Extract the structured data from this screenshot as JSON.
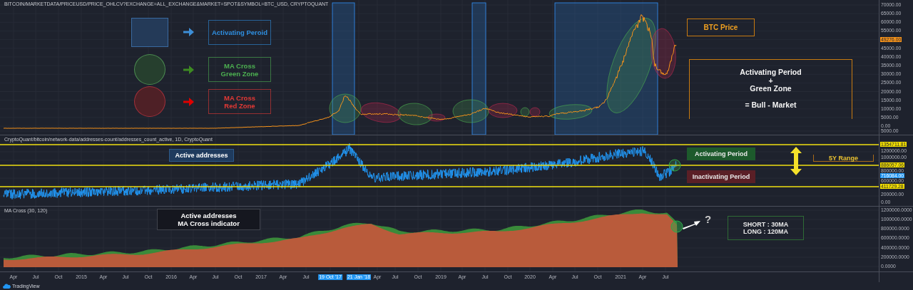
{
  "price_panel": {
    "source": "BITCOIN/MARKETDATA/PRICEUSD/PRICE_OHLCV?EXCHANGE=ALL_EXCHANGE&MARKET=SPOT&SYMBOL=BTC_USD, CRYPTOQUANT",
    "legend": [
      {
        "kind": "period",
        "lines": [
          "Activating Peroid"
        ]
      },
      {
        "kind": "green",
        "lines": [
          "MA Cross",
          "Green Zone"
        ]
      },
      {
        "kind": "red",
        "lines": [
          "MA Cross",
          "Red Zone"
        ]
      }
    ],
    "zones": [
      {
        "kind": "green"
      },
      {
        "kind": "red"
      },
      {
        "kind": "green"
      },
      {
        "kind": "red"
      },
      {
        "kind": "green"
      },
      {
        "kind": "red"
      },
      {
        "kind": "green"
      },
      {
        "kind": "red"
      },
      {
        "kind": "green"
      },
      {
        "kind": "green"
      },
      {
        "kind": "red"
      }
    ],
    "series_label": "BTC Price",
    "summary": [
      "Activating Period",
      "+",
      "Green Zone",
      "= Bull - Market"
    ],
    "axis": [
      {
        "text": "70000.00",
        "kind": "tick"
      },
      {
        "text": "65000.00",
        "kind": "tick"
      },
      {
        "text": "60000.00",
        "kind": "tick"
      },
      {
        "text": "55000.00",
        "kind": "tick"
      },
      {
        "text": "49276.00",
        "kind": "price"
      },
      {
        "text": "45000.00",
        "kind": "tick"
      },
      {
        "text": "40000.00",
        "kind": "tick"
      },
      {
        "text": "35000.00",
        "kind": "tick"
      },
      {
        "text": "30000.00",
        "kind": "tick"
      },
      {
        "text": "25000.00",
        "kind": "tick"
      },
      {
        "text": "20000.00",
        "kind": "tick"
      },
      {
        "text": "15000.00",
        "kind": "tick"
      },
      {
        "text": "10000.00",
        "kind": "tick"
      },
      {
        "text": "5000.00",
        "kind": "tick"
      },
      {
        "text": "0.00",
        "kind": "tick"
      },
      {
        "text": "5000.00",
        "kind": "tick"
      }
    ]
  },
  "address_panel": {
    "source": "CryptoQuant/bitcoin/network-data/addresses-count/addresses_count_active, 1D, CryptoQuant",
    "title": "Active addresses",
    "states": [
      {
        "kind": "active",
        "label": "Activating Period"
      },
      {
        "kind": "inactive",
        "label": "Inactivating Period"
      }
    ],
    "range_label": "5Y Range",
    "axis": [
      {
        "text": "1354711.81",
        "kind": "level"
      },
      {
        "text": "1200000.00",
        "kind": "tick"
      },
      {
        "text": "1000000.00",
        "kind": "tick"
      },
      {
        "text": "886057.06",
        "kind": "level"
      },
      {
        "text": "800000.00",
        "kind": "tick"
      },
      {
        "text": "716084.00",
        "kind": "current"
      },
      {
        "text": "600000.00",
        "kind": "tick"
      },
      {
        "text": "411729.28",
        "kind": "level"
      },
      {
        "text": "200000.00",
        "kind": "tick"
      },
      {
        "text": "0.00",
        "kind": "tick"
      }
    ]
  },
  "ma_panel": {
    "source": "MA Cross (30, 120)",
    "title": [
      "Active addresses",
      "MA Cross indicator"
    ],
    "question": "?",
    "settings": [
      "SHORT : 30MA",
      "LONG : 120MA"
    ],
    "axis": [
      {
        "text": "1200000.0000"
      },
      {
        "text": "1000000.0000"
      },
      {
        "text": "800000.0000"
      },
      {
        "text": "600000.0000"
      },
      {
        "text": "400000.0000"
      },
      {
        "text": "200000.0000"
      },
      {
        "text": "0.0000"
      }
    ]
  },
  "time_axis": [
    {
      "label": "Apr",
      "highlighted": false
    },
    {
      "label": "Jul",
      "highlighted": false
    },
    {
      "label": "Oct",
      "highlighted": false
    },
    {
      "label": "2015",
      "highlighted": false
    },
    {
      "label": "Apr",
      "highlighted": false
    },
    {
      "label": "Jul",
      "highlighted": false
    },
    {
      "label": "Oct",
      "highlighted": false
    },
    {
      "label": "2016",
      "highlighted": false
    },
    {
      "label": "Apr",
      "highlighted": false
    },
    {
      "label": "Jul",
      "highlighted": false
    },
    {
      "label": "Oct",
      "highlighted": false
    },
    {
      "label": "2017",
      "highlighted": false
    },
    {
      "label": "Apr",
      "highlighted": false
    },
    {
      "label": "Jul",
      "highlighted": false
    },
    {
      "label": "19 Oct '17",
      "highlighted": true
    },
    {
      "label": "21 Jan '18",
      "highlighted": true
    },
    {
      "label": "Apr",
      "highlighted": false
    },
    {
      "label": "Jul",
      "highlighted": false
    },
    {
      "label": "Oct",
      "highlighted": false
    },
    {
      "label": "2019",
      "highlighted": false
    },
    {
      "label": "Apr",
      "highlighted": false
    },
    {
      "label": "Jul",
      "highlighted": false
    },
    {
      "label": "Oct",
      "highlighted": false
    },
    {
      "label": "2020",
      "highlighted": false
    },
    {
      "label": "Apr",
      "highlighted": false
    },
    {
      "label": "Jul",
      "highlighted": false
    },
    {
      "label": "Oct",
      "highlighted": false
    },
    {
      "label": "2021",
      "highlighted": false
    },
    {
      "label": "Apr",
      "highlighted": false
    },
    {
      "label": "Jul",
      "highlighted": false
    }
  ],
  "footer": {
    "brand": "TradingView"
  }
}
